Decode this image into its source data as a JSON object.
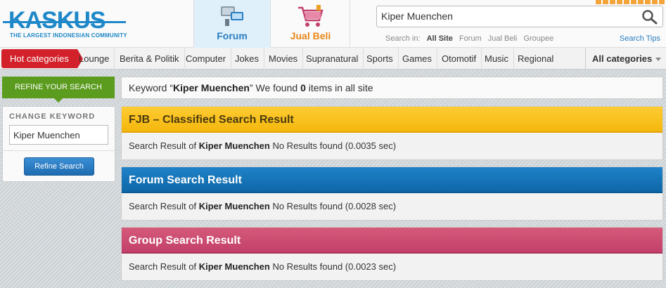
{
  "header": {
    "logo_text": "KASKUS",
    "logo_tagline": "THE LARGEST INDONESIAN COMMUNITY",
    "nav": [
      {
        "label": "Forum"
      },
      {
        "label": "Jual Beli"
      }
    ],
    "search": {
      "value": "Kiper Muenchen",
      "search_in_label": "Search in:",
      "scopes": [
        "All Site",
        "Forum",
        "Jual Beli",
        "Groupee"
      ],
      "active_scope": "All Site",
      "tips_label": "Search Tips"
    }
  },
  "categories": {
    "hot_label": "Hot categories",
    "items": [
      "Lounge",
      "Berita & Politik",
      "Computer",
      "Jokes",
      "Movies",
      "Supranatural",
      "Sports",
      "Games",
      "Otomotif",
      "Music",
      "Regional"
    ],
    "all_label": "All categories"
  },
  "refine": {
    "tab_label": "REFINE YOUR SEARCH",
    "keyword_prefix": "Keyword “",
    "keyword": "Kiper Muenchen",
    "keyword_mid": "” We found ",
    "count": "0",
    "keyword_suffix": " items in all site"
  },
  "sidebar": {
    "title": "CHANGE KEYWORD",
    "input_value": "Kiper Muenchen",
    "button_label": "Refine Search"
  },
  "results": [
    {
      "title": "FJB – Classified Search Result",
      "prefix": "Search Result of ",
      "keyword": "Kiper Muenchen",
      "suffix": "  No Results found (0.0035 sec)"
    },
    {
      "title": "Forum Search Result",
      "prefix": "Search Result of ",
      "keyword": "Kiper Muenchen",
      "suffix": " No Results found (0.0028 sec)"
    },
    {
      "title": "Group Search Result",
      "prefix": "Search Result of ",
      "keyword": "Kiper Muenchen",
      "suffix": " No Results found (0.0023 sec)"
    }
  ],
  "colors": {
    "brand_blue": "#1e88c8",
    "hot_red": "#d3212b",
    "refine_green": "#5b9b1e",
    "fjb_yellow": "#f4b70d",
    "forum_blue": "#0e67a8",
    "group_pink": "#c2406a"
  },
  "icons": [
    "search-icon",
    "forum-icon",
    "shopping-cart-icon",
    "chevron-down-icon"
  ]
}
